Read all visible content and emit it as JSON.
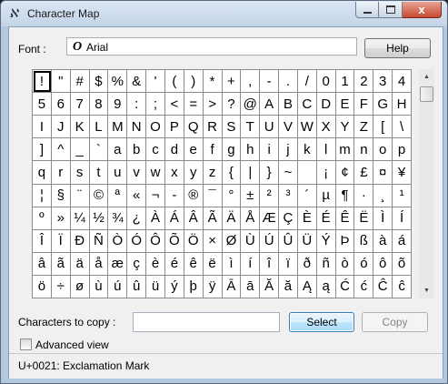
{
  "window": {
    "title": "Character Map",
    "icon_glyph": "ℵ",
    "caption": {
      "min_icon": "minimize-icon",
      "max_icon": "maximize-icon",
      "close_glyph": "x"
    }
  },
  "font": {
    "label": "Font :",
    "icon_glyph": "O",
    "value": "Arial",
    "help_label": "Help"
  },
  "grid": {
    "rows": [
      [
        "!",
        "\"",
        "#",
        "$",
        "%",
        "&",
        "'",
        "(",
        ")",
        "*",
        "+",
        ",",
        "-",
        ".",
        "/",
        "0",
        "1",
        "2",
        "3",
        "4"
      ],
      [
        "5",
        "6",
        "7",
        "8",
        "9",
        ":",
        ";",
        "<",
        "=",
        ">",
        "?",
        "@",
        "A",
        "B",
        "C",
        "D",
        "E",
        "F",
        "G",
        "H"
      ],
      [
        "I",
        "J",
        "K",
        "L",
        "M",
        "N",
        "O",
        "P",
        "Q",
        "R",
        "S",
        "T",
        "U",
        "V",
        "W",
        "X",
        "Y",
        "Z",
        "[",
        "\\"
      ],
      [
        "]",
        "^",
        "_",
        "`",
        "a",
        "b",
        "c",
        "d",
        "e",
        "f",
        "g",
        "h",
        "i",
        "j",
        "k",
        "l",
        "m",
        "n",
        "o",
        "p"
      ],
      [
        "q",
        "r",
        "s",
        "t",
        "u",
        "v",
        "w",
        "x",
        "y",
        "z",
        "{",
        "|",
        "}",
        "~",
        " ",
        "¡",
        "¢",
        "£",
        "¤",
        "¥"
      ],
      [
        "¦",
        "§",
        "¨",
        "©",
        "ª",
        "«",
        "¬",
        "-",
        "®",
        "¯",
        "°",
        "±",
        "²",
        "³",
        "´",
        "µ",
        "¶",
        "·",
        "¸",
        "¹"
      ],
      [
        "º",
        "»",
        "¼",
        "½",
        "¾",
        "¿",
        "À",
        "Á",
        "Â",
        "Ã",
        "Ä",
        "Å",
        "Æ",
        "Ç",
        "È",
        "É",
        "Ê",
        "Ë",
        "Ì",
        "Í"
      ],
      [
        "Î",
        "Ï",
        "Ð",
        "Ñ",
        "Ò",
        "Ó",
        "Ô",
        "Õ",
        "Ö",
        "×",
        "Ø",
        "Ù",
        "Ú",
        "Û",
        "Ü",
        "Ý",
        "Þ",
        "ß",
        "à",
        "á"
      ],
      [
        "â",
        "ã",
        "ä",
        "å",
        "æ",
        "ç",
        "è",
        "é",
        "ê",
        "ë",
        "ì",
        "í",
        "î",
        "ï",
        "ð",
        "ñ",
        "ò",
        "ó",
        "ô",
        "õ"
      ],
      [
        "ö",
        "÷",
        "ø",
        "ù",
        "ú",
        "û",
        "ü",
        "ý",
        "þ",
        "ÿ",
        "Ā",
        "ā",
        "Ă",
        "ă",
        "Ą",
        "ą",
        "Ć",
        "ć",
        "Ĉ",
        "ĉ"
      ]
    ],
    "selected": "!"
  },
  "scrollbar": {
    "up_glyph": "▲",
    "down_glyph": "▼"
  },
  "copy": {
    "label": "Characters to copy :",
    "value": "",
    "select_label": "Select",
    "copy_label": "Copy"
  },
  "advanced": {
    "label": "Advanced view",
    "checked": false
  },
  "status": {
    "text": "U+0021: Exclamation Mark"
  }
}
